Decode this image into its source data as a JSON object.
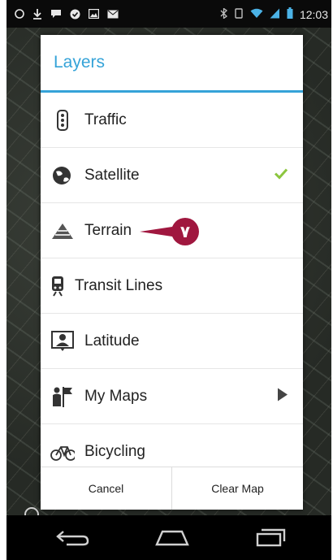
{
  "status_bar": {
    "time": "12:03",
    "icons": [
      "circle-icon",
      "download-icon",
      "chat-icon",
      "check-icon",
      "image-icon",
      "mail-icon",
      "bluetooth-icon",
      "rotate-icon",
      "wifi-icon",
      "signal-icon",
      "battery-icon"
    ]
  },
  "dialog": {
    "title": "Layers",
    "items": [
      {
        "label": "Traffic",
        "icon": "traffic-light-icon"
      },
      {
        "label": "Satellite",
        "icon": "globe-icon",
        "checked": true
      },
      {
        "label": "Terrain",
        "icon": "terrain-icon"
      },
      {
        "label": "Transit Lines",
        "icon": "train-icon"
      },
      {
        "label": "Latitude",
        "icon": "person-badge-icon"
      },
      {
        "label": "My Maps",
        "icon": "my-maps-icon",
        "has_submenu": true
      },
      {
        "label": "Bicycling",
        "icon": "bicycle-icon"
      }
    ],
    "cancel_label": "Cancel",
    "clear_label": "Clear Map"
  },
  "callout": {
    "number": "٧",
    "color": "#a0173f"
  },
  "colors": {
    "accent": "#35a3d8",
    "check": "#8cc63f"
  },
  "nav": {
    "icons": [
      "back-icon",
      "home-icon",
      "recents-icon"
    ]
  }
}
